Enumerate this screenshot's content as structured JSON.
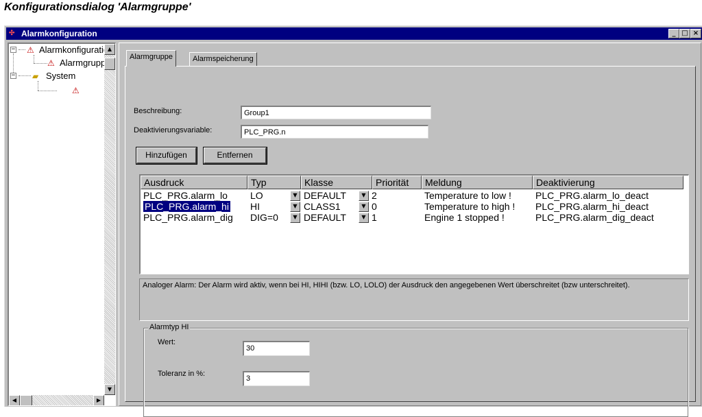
{
  "page_title": "Konfigurationsdialog 'Alarmgruppe'",
  "window": {
    "title": "Alarmkonfiguration",
    "controls": {
      "minimize": "_",
      "maximize": "□",
      "close": "×"
    }
  },
  "tree": {
    "nodes": [
      {
        "label": "Alarmkonfiguration",
        "icon": "alarm-config-icon"
      },
      {
        "label": "Alarmgruppe",
        "icon": "alarm-group-icon"
      },
      {
        "label": "System",
        "icon": "folder-icon"
      },
      {
        "label": "",
        "icon": "alarm-item-icon"
      }
    ]
  },
  "tabs": [
    {
      "label": "Alarmgruppe",
      "active": true
    },
    {
      "label": "Alarmspeicherung",
      "active": false
    }
  ],
  "form": {
    "beschreibung_label": "Beschreibung:",
    "beschreibung_value": "Group1",
    "deakt_label": "Deaktivierungsvariable:",
    "deakt_value": "PLC_PRG.n",
    "add_button": "Hinzufügen",
    "remove_button": "Entfernen"
  },
  "table": {
    "headers": [
      "Ausdruck",
      "Typ",
      "Klasse",
      "Priorität",
      "Meldung",
      "Deaktivierung"
    ],
    "rows": [
      {
        "ausdruck": "PLC_PRG.alarm_lo",
        "typ": "LO",
        "klasse": "DEFAULT",
        "prioritaet": "2",
        "meldung": "Temperature to low !",
        "deaktivierung": "PLC_PRG.alarm_lo_deact",
        "selected": false
      },
      {
        "ausdruck": "PLC_PRG.alarm_hi",
        "typ": "HI",
        "klasse": "CLASS1",
        "prioritaet": "0",
        "meldung": "Temperature to high !",
        "deaktivierung": "PLC_PRG.alarm_hi_deact",
        "selected": true
      },
      {
        "ausdruck": "PLC_PRG.alarm_dig",
        "typ": "DIG=0",
        "klasse": "DEFAULT",
        "prioritaet": "1",
        "meldung": "Engine 1 stopped !",
        "deaktivierung": "PLC_PRG.alarm_dig_deact",
        "selected": false
      }
    ]
  },
  "description_text": "Analoger Alarm: Der Alarm wird aktiv, wenn bei HI, HIHI (bzw. LO, LOLO) der Ausdruck den angegebenen Wert überschreitet (bzw unterschreitet).",
  "alarmtyp": {
    "group_label": "Alarmtyp HI",
    "wert_label": "Wert:",
    "wert_value": "30",
    "toleranz_label": "Toleranz in %:",
    "toleranz_value": "3"
  }
}
